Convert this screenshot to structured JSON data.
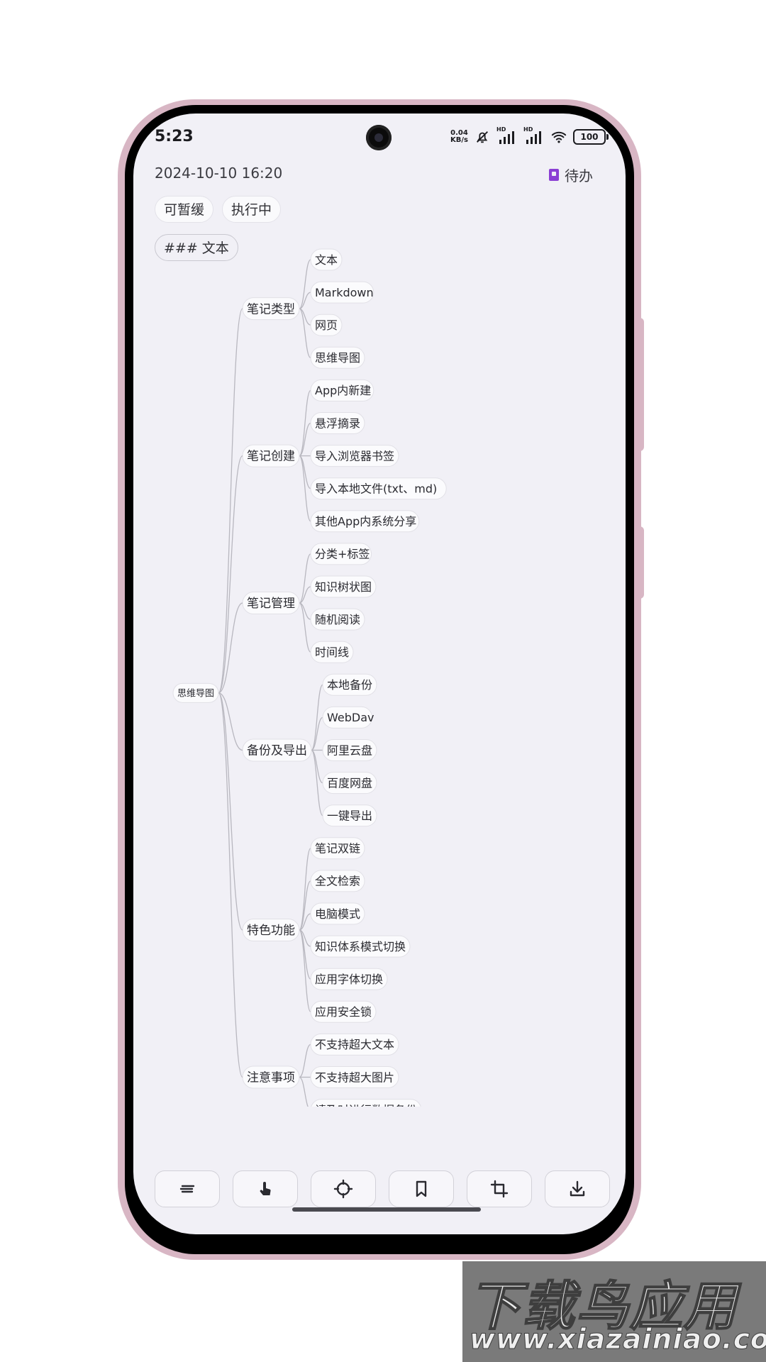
{
  "status_bar": {
    "time": "5:23",
    "net_speed_value": "0.04",
    "net_speed_unit": "KB/s",
    "hd_label_1": "HD",
    "hd_label_2": "HD",
    "battery": "100",
    "icons": [
      "mute-bell-icon",
      "signal-icon",
      "signal-icon",
      "wifi-icon",
      "battery-icon"
    ]
  },
  "note": {
    "date": "2024-10-10 16:20",
    "category": "待办",
    "category_color": "#8b3fd4",
    "tags": [
      "可暂缓",
      "执行中"
    ],
    "heading_chip": "### 文本"
  },
  "mindmap": {
    "root": "思维导图",
    "branches": [
      {
        "label": "笔记类型",
        "children": [
          "文本",
          "Markdown",
          "网页",
          "思维导图"
        ]
      },
      {
        "label": "笔记创建",
        "children": [
          "App内新建",
          "悬浮摘录",
          "导入浏览器书签",
          "导入本地文件(txt、md)",
          "其他App内系统分享"
        ]
      },
      {
        "label": "笔记管理",
        "children": [
          "分类+标签",
          "知识树状图",
          "随机阅读",
          "时间线"
        ]
      },
      {
        "label": "备份及导出",
        "children": [
          "本地备份",
          "WebDav",
          "阿里云盘",
          "百度网盘",
          "一键导出"
        ]
      },
      {
        "label": "特色功能",
        "children": [
          "笔记双链",
          "全文检索",
          "电脑模式",
          "知识体系模式切换",
          "应用字体切换",
          "应用安全锁"
        ]
      },
      {
        "label": "注意事项",
        "children": [
          "不支持超大文本",
          "不支持超大图片",
          "请及时进行数据备份"
        ]
      }
    ]
  },
  "toolbar": {
    "buttons": [
      "outline-icon",
      "touch-hand-icon",
      "locate-center-icon",
      "bookmark-icon",
      "crop-icon",
      "download-icon"
    ]
  },
  "watermark": {
    "brand": "下载鸟应用",
    "url": "www.xiazainiao.com"
  }
}
